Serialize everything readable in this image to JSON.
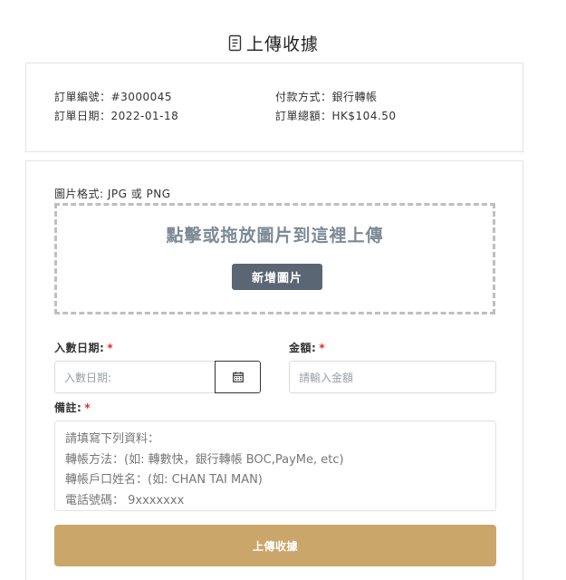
{
  "page": {
    "title": "上傳收據",
    "title_icon": "receipt-icon"
  },
  "order": {
    "number_label": "訂單編號：",
    "number": "#3000045",
    "date_label": "訂單日期：",
    "date": "2022-01-18",
    "payment_label": "付款方式：",
    "payment": "銀行轉帳",
    "total_label": "訂單總額：",
    "total": "HK$104.50"
  },
  "upload": {
    "format_label": "圖片格式: JPG 或 PNG",
    "drop_text": "點擊或拖放圖片到這裡上傳",
    "add_button": "新增圖片"
  },
  "form": {
    "required_mark": "*",
    "date_label": "入數日期:",
    "date_placeholder": "入數日期:",
    "calendar_icon": "calendar-icon",
    "amount_label": "金額:",
    "amount_placeholder": "請輸入金額",
    "remarks_label": "備註:",
    "remarks_lines": [
      "請填寫下列資料：",
      "轉帳方法：(如: 轉數快，銀行轉帳 BOC,PayMe, etc)",
      "轉帳戶口姓名：(如: CHAN TAI MAN)",
      "電話號碼： 9xxxxxxx"
    ],
    "submit": "上傳收據"
  },
  "colors": {
    "submit_bg": "#caa66a",
    "add_button_bg": "#5b6674",
    "drop_text": "#7d8a96",
    "required": "#d9302c"
  }
}
